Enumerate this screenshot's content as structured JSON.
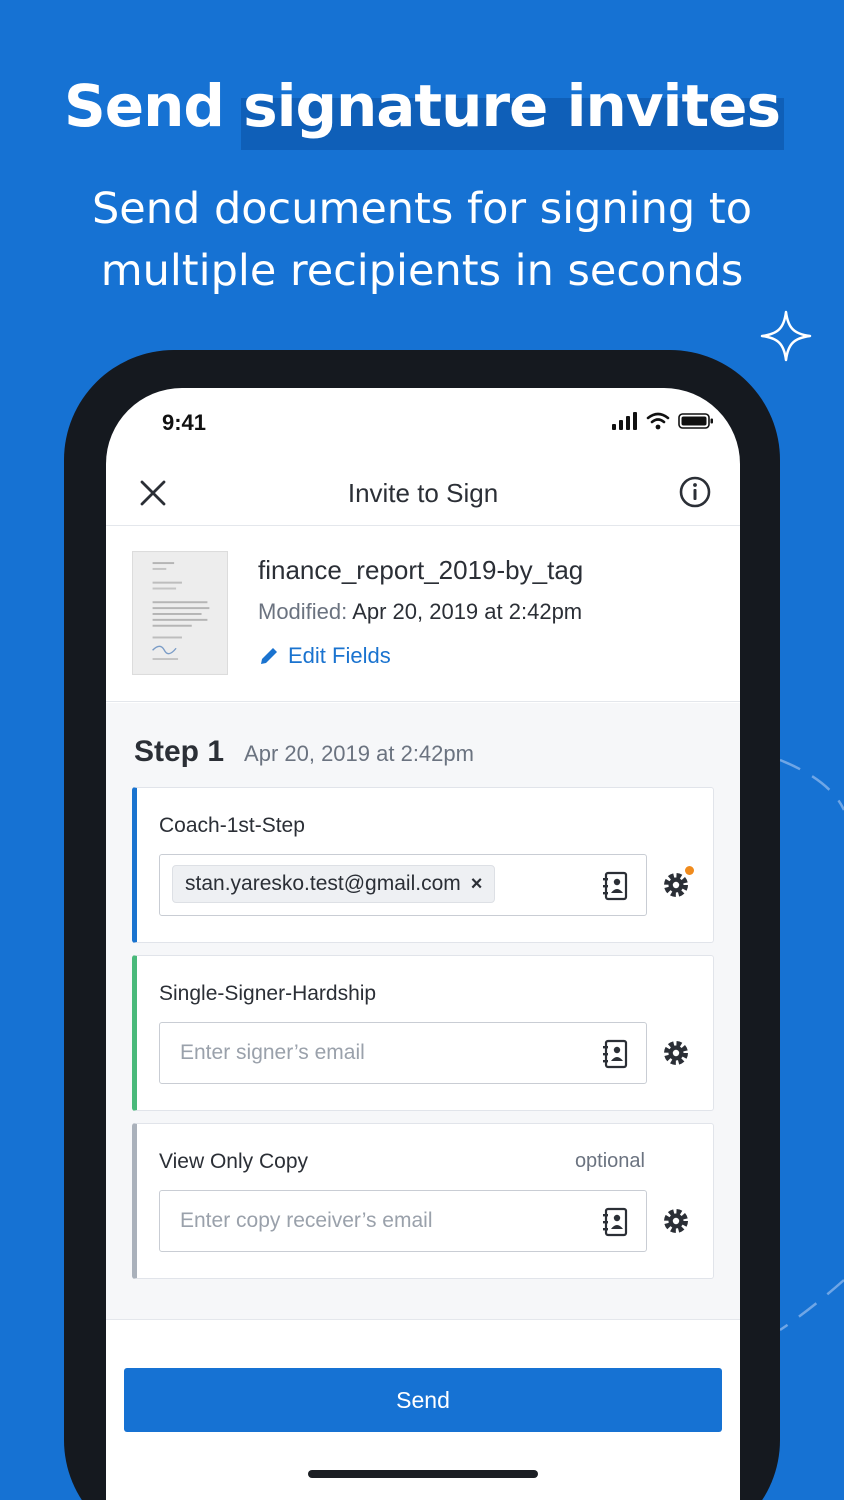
{
  "promo": {
    "headline_plain": "Send",
    "headline_highlight": "signature invites",
    "subtitle_line1": "Send documents for signing to",
    "subtitle_line2": "multiple recipients in seconds"
  },
  "status_bar": {
    "time": "9:41"
  },
  "nav": {
    "title": "Invite to Sign"
  },
  "document": {
    "name": "finance_report_2019-by_tag",
    "modified_label": "Modified:",
    "modified_value": "Apr 20, 2019 at 2:42pm",
    "edit_fields_label": "Edit Fields"
  },
  "step": {
    "title": "Step 1",
    "date": "Apr 20, 2019 at 2:42pm",
    "cards": [
      {
        "role": "Coach-1st-Step",
        "accent": "#1a73cf",
        "email_chip": "stan.yaresko.test@gmail.com",
        "chip_remove": "×"
      },
      {
        "role": "Single-Signer-Hardship",
        "accent": "#49b97a",
        "placeholder": "Enter signer’s email"
      },
      {
        "role": "View Only Copy",
        "accent": "#aab1bb",
        "optional": "optional",
        "placeholder": "Enter copy receiver’s email"
      }
    ]
  },
  "send_label": "Send",
  "colors": {
    "brand": "#1672d3",
    "link": "#1a73cf",
    "notification_dot": "#f08b1d"
  }
}
